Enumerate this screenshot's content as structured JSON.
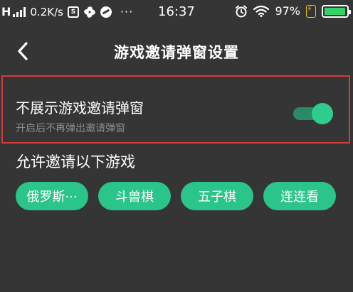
{
  "status_bar": {
    "network_type": "H",
    "speed": "0.2K/s",
    "more": "···",
    "time": "16:37",
    "battery_percent": "97%",
    "battery_level": 0.97,
    "icons": [
      "signal-icon",
      "sim-icon",
      "pinwheel-icon",
      "ball-icon",
      "alarm-icon",
      "wifi-icon",
      "charging-icon",
      "battery-icon"
    ]
  },
  "header": {
    "title": "游戏邀请弹窗设置",
    "back_icon": "chevron-left-icon"
  },
  "setting": {
    "label": "不展示游戏邀请弹窗",
    "description": "开启后不再弹出邀请弹窗",
    "toggle_on": true,
    "highlight_color": "#d33a3a"
  },
  "games": {
    "heading": "允许邀请以下游戏",
    "items": [
      {
        "label": "俄罗斯···"
      },
      {
        "label": "斗兽棋"
      },
      {
        "label": "五子棋"
      },
      {
        "label": "连连看"
      }
    ]
  },
  "colors": {
    "background": "#353535",
    "accent": "#2bc48a",
    "toggle_track": "#2a8a66",
    "secondary_text": "#8e8e8e"
  }
}
